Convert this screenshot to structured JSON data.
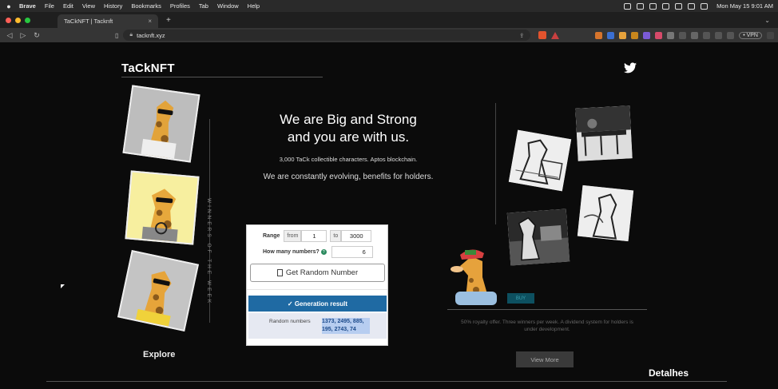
{
  "menubar": {
    "items": [
      "Brave",
      "File",
      "Edit",
      "View",
      "History",
      "Bookmarks",
      "Profiles",
      "Tab",
      "Window",
      "Help"
    ],
    "clock": "Mon May 15  9:01 AM"
  },
  "browser": {
    "tab_title": "TaCkNFT | Tacknft",
    "tab_close": "×",
    "new_tab": "+",
    "url": "tacknft.xyz",
    "vpn": "• VPN"
  },
  "site": {
    "logo": "TaCkNFT",
    "winners_label": "WINNERS OF THE WEEK",
    "explore": "Explore",
    "hero_line1": "We are Big and Strong",
    "hero_line2": "and you are with us.",
    "sub1": "3,000 TaCk collectible characters. Aptos blockchain.",
    "sub2": "We are constantly evolving, benefits for holders.",
    "teal_button": "BUY",
    "royalty_text": "50% royalty offer. Three winners per week. A dividend system for holders is under development.",
    "view_more": "View More",
    "detalhes": "Detalhes"
  },
  "widget": {
    "range_label": "Range",
    "from_label": "from",
    "from_value": "1",
    "to_label": "to",
    "to_value": "3000",
    "how_many_label": "How many numbers?",
    "how_many_value": "6",
    "help_icon": "?",
    "button_label": "Get Random Number",
    "result_label": "✓ Generation result",
    "numbers_label": "Random numbers",
    "numbers": "1373, 2495, 885, 195, 2743, 74"
  },
  "colors": {
    "background": "#0b0b0b",
    "result_bar": "#1f6aa3",
    "teal": "#0d5060"
  }
}
